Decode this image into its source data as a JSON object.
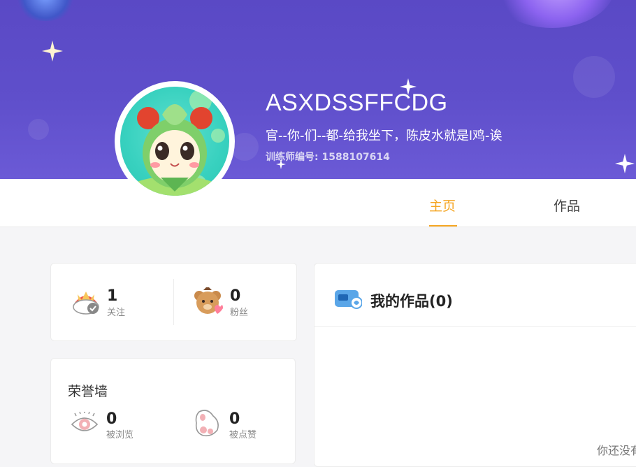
{
  "profile": {
    "name": "ASXDSSFFCDG",
    "bio": "官--你-们--都-给我坐下，陈皮水就是l鸡-诶",
    "trainer_id_label": "训练师编号:",
    "trainer_id": "1588107614"
  },
  "tabs": [
    {
      "label": "主页",
      "active": true
    },
    {
      "label": "作品",
      "active": false
    }
  ],
  "stats": {
    "following": {
      "value": "1",
      "label": "关注"
    },
    "fans": {
      "value": "0",
      "label": "粉丝"
    }
  },
  "honor": {
    "title": "荣誉墙",
    "views": {
      "value": "0",
      "label": "被浏览"
    },
    "likes": {
      "value": "0",
      "label": "被点赞"
    }
  },
  "works": {
    "title": "我的作品(0)",
    "empty_text": "你还没有"
  },
  "colors": {
    "banner": "#5f4fcb",
    "accent": "#f5a623"
  }
}
